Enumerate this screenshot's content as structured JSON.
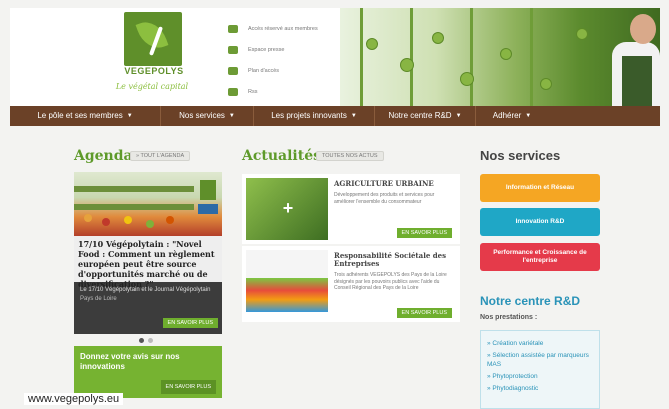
{
  "header": {
    "logo_name": "VEGEPOLYS",
    "logo_tagline": "Le végétal capital",
    "quick_links": [
      "Accès réservé aux membres",
      "Espace presse",
      "Plan d'accès",
      "Rss"
    ]
  },
  "nav": {
    "items": [
      "Le pôle et ses membres",
      "Nos services",
      "Les projets innovants",
      "Notre centre R&D",
      "Adhérer"
    ]
  },
  "agenda": {
    "title": "Agenda",
    "all_label": "» TOUT L'AGENDA",
    "headline": "17/10 Végépolytain : \"Novel Food : Comment un règlement européen peut être source d'opportunités marché ou de diversification ?\"",
    "meta": "Le 17/10 Végépolytain et le Journal Végépolytain",
    "place": "Pays de Loire",
    "more_label": "EN SAVOIR PLUS",
    "feedback": "Donnez votre avis sur nos innovations",
    "feedback_more": "EN SAVOIR PLUS"
  },
  "news": {
    "title": "Actualités",
    "all_label": "TOUTES NOS ACTUS",
    "items": [
      {
        "title": "AGRICULTURE URBAINE",
        "desc": "Développement des produits et services pour améliorer l'ensemble du consommateur",
        "more": "EN SAVOIR PLUS"
      },
      {
        "title": "Responsabilité Sociétale des Entreprises",
        "desc": "Trois adhérents VEGEPOLYS des Pays de la Loire désignés par les pouvoirs publics avec l'aide du Conseil Régional des Pays de la Loire",
        "more": "EN SAVOIR PLUS"
      }
    ]
  },
  "services": {
    "title": "Nos services",
    "items": [
      {
        "label": "Information et Réseau",
        "color": "#f5a623"
      },
      {
        "label": "Innovation R&D",
        "color": "#1fa7c6"
      },
      {
        "label": "Performance et Croissance de l'entreprise",
        "color": "#e53a4a"
      }
    ]
  },
  "rd": {
    "title": "Notre centre R&D",
    "subtitle": "Nos prestations :",
    "items": [
      "Création variétale",
      "Sélection assistée par marqueurs MAS",
      "Phytoprotection",
      "Phytodiagnostic"
    ]
  },
  "footer": {
    "url": "www.vegepolys.eu"
  }
}
